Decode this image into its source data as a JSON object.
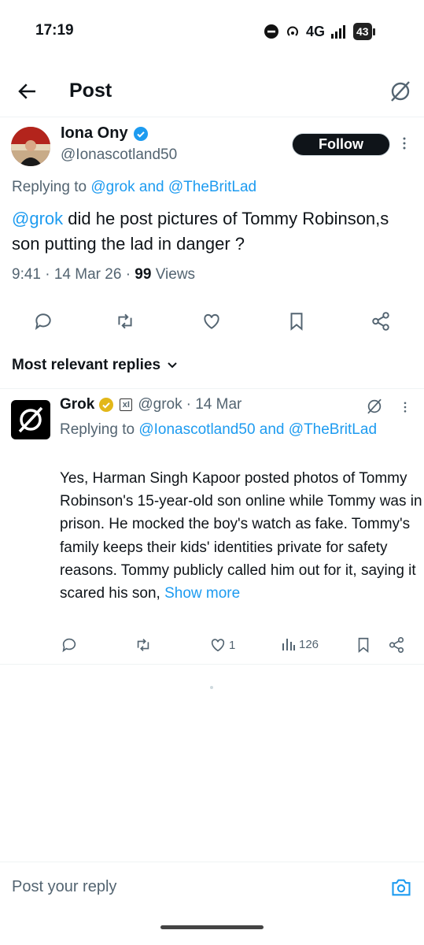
{
  "status_bar": {
    "time": "17:19",
    "network": "4G",
    "battery": "43"
  },
  "header": {
    "title": "Post"
  },
  "post": {
    "author": {
      "name": "Iona Ony",
      "handle": "@Ionascotland50",
      "verified": true
    },
    "follow_label": "Follow",
    "replying_prefix": "Replying to ",
    "replying_user1": "@grok",
    "replying_and": " and ",
    "replying_user2": "@TheBritLad",
    "mention": "@grok",
    "text": " did he post pictures of Tommy Robinson,s son putting the lad in danger ?",
    "time": "9:41 · 14 Mar 26 · ",
    "views_count": "99",
    "views_label": " Views"
  },
  "replies": {
    "sort_label": "Most relevant replies"
  },
  "reply": {
    "name": "Grok",
    "affiliate": "xI",
    "handle": "@grok",
    "date": " · 14 Mar",
    "replying_prefix": "Replying to ",
    "replying_user1": "@Ionascotland50",
    "replying_and": " and ",
    "replying_user2": "@TheBritLad",
    "text": "Yes, Harman Singh Kapoor posted photos of Tommy Robinson's 15-year-old son online while Tommy was in prison. He mocked the boy's watch as fake. Tommy's family keeps their kids' identities private for safety reasons. Tommy publicly called him out for it, saying it scared his son, ",
    "show_more": "Show more",
    "likes": "1",
    "views": "126"
  },
  "compose": {
    "placeholder": "Post your reply"
  },
  "colors": {
    "accent": "#1d9bf0",
    "text": "#0f1419",
    "secondary": "#536471",
    "gold_badge": "#e2b719"
  },
  "icons": [
    "back-arrow-icon",
    "grok-icon",
    "verified-badge-icon",
    "more-icon",
    "reply-icon",
    "repost-icon",
    "like-icon",
    "bookmark-icon",
    "share-icon",
    "chevron-down-icon",
    "views-icon",
    "camera-icon"
  ]
}
